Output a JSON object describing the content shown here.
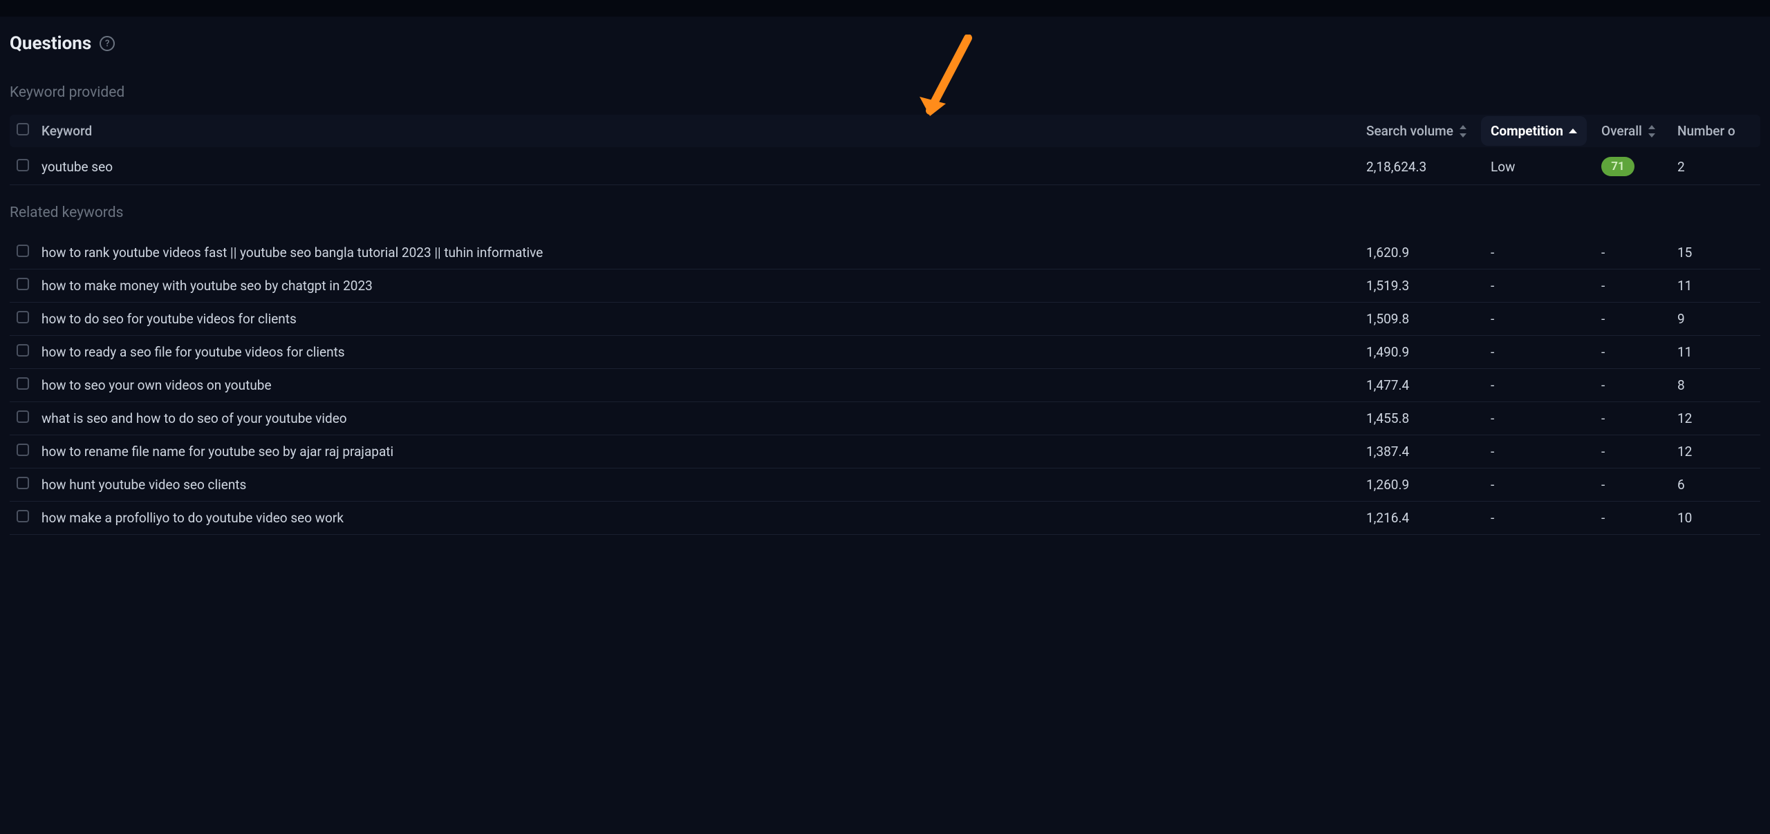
{
  "section": {
    "title": "Questions",
    "help_label": "?"
  },
  "subsections": {
    "provided": "Keyword provided",
    "related": "Related keywords"
  },
  "columns": {
    "keyword": "Keyword",
    "volume": "Search volume",
    "competition": "Competition",
    "overall": "Overall",
    "number": "Number o"
  },
  "provided_rows": [
    {
      "keyword": "youtube seo",
      "volume": "2,18,624.3",
      "competition": "Low",
      "overall": "71",
      "number": "2"
    }
  ],
  "related_rows": [
    {
      "keyword": "how to rank youtube videos fast || youtube seo bangla tutorial 2023 || tuhin informative",
      "volume": "1,620.9",
      "competition": "-",
      "overall": "-",
      "number": "15"
    },
    {
      "keyword": "how to make money with youtube seo by chatgpt in 2023",
      "volume": "1,519.3",
      "competition": "-",
      "overall": "-",
      "number": "11"
    },
    {
      "keyword": "how to do seo for youtube videos for clients",
      "volume": "1,509.8",
      "competition": "-",
      "overall": "-",
      "number": "9"
    },
    {
      "keyword": "how to ready a seo file for youtube videos for clients",
      "volume": "1,490.9",
      "competition": "-",
      "overall": "-",
      "number": "11"
    },
    {
      "keyword": "how to seo your own videos on youtube",
      "volume": "1,477.4",
      "competition": "-",
      "overall": "-",
      "number": "8"
    },
    {
      "keyword": "what is seo and how to do seo of your youtube video",
      "volume": "1,455.8",
      "competition": "-",
      "overall": "-",
      "number": "12"
    },
    {
      "keyword": "how to rename file name for youtube seo by ajar raj prajapati",
      "volume": "1,387.4",
      "competition": "-",
      "overall": "-",
      "number": "12"
    },
    {
      "keyword": "how hunt youtube video seo clients",
      "volume": "1,260.9",
      "competition": "-",
      "overall": "-",
      "number": "6"
    },
    {
      "keyword": "how make a profolliyo to do youtube video seo work",
      "volume": "1,216.4",
      "competition": "-",
      "overall": "-",
      "number": "10"
    }
  ]
}
